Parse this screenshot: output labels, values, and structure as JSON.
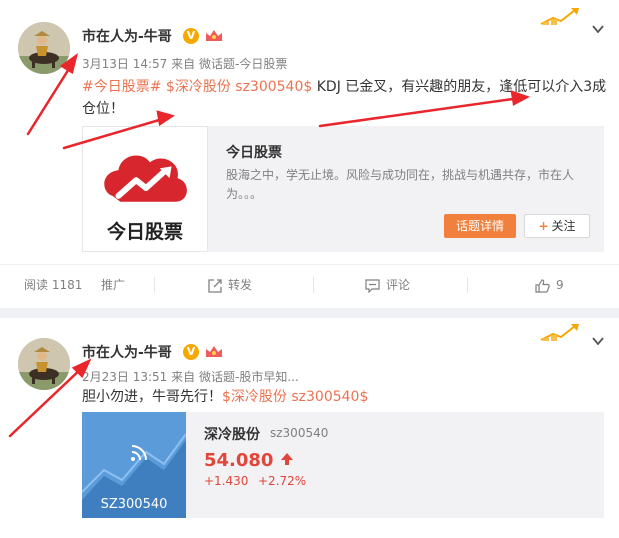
{
  "posts": [
    {
      "author": "市在人为-牛哥",
      "verified_mark": "V",
      "date": "3月13日 14:57",
      "source_prefix": "来自",
      "source": "微话题-今日股票",
      "text": {
        "topic": "#今日股票#",
        "stock": "$深冷股份 sz300540$",
        "body": " KDJ 已金叉，有兴趣的朋友，逢低可以介入3成仓位！"
      },
      "share_card": {
        "title": "今日股票",
        "description": "股海之中，学无止境。风险与成功同在，挑战与机遇共存，市在人为。。。",
        "logo_text": "今日股票",
        "topic_button": "话题详情",
        "follow_button": "关注"
      },
      "actions": {
        "read_label": "阅读",
        "read_count": "1181",
        "promote": "推广",
        "repost": "转发",
        "comment": "评论",
        "like_count": "9"
      }
    },
    {
      "author": "市在人为-牛哥",
      "verified_mark": "V",
      "date": "2月23日 13:51",
      "source_prefix": "来自",
      "source": "微话题-股市早知...",
      "text": {
        "body": "胆小勿进，牛哥先行！",
        "stock": "$深冷股份 sz300540$"
      },
      "stock_card": {
        "name": "深冷股份",
        "code": "sz300540",
        "image_code": "SZ300540",
        "price": "54.080",
        "change": "+1.430",
        "change_pct": "+2.72%"
      }
    }
  ],
  "colors": {
    "link": "#eb7350",
    "arrow": "#e8262b",
    "up": "#e0463a",
    "brand_red": "#d7262e",
    "button_orange": "#f0803c"
  },
  "icons": [
    "chevron-down-icon",
    "crown-icon",
    "repost-icon",
    "comment-icon",
    "thumbs-up-icon",
    "trend-up-icon"
  ]
}
